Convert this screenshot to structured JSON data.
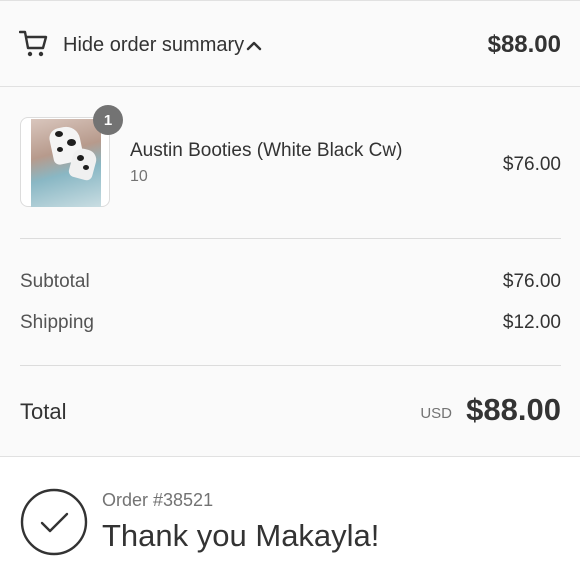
{
  "summary_toggle": {
    "label": "Hide order summary",
    "total": "$88.00",
    "icons": [
      "cart-icon",
      "chevron-up-icon"
    ]
  },
  "line_items": [
    {
      "name": "Austin Booties (White Black Cw)",
      "variant": "10",
      "quantity": "1",
      "price": "$76.00"
    }
  ],
  "costs": {
    "subtotal_label": "Subtotal",
    "subtotal_value": "$76.00",
    "shipping_label": "Shipping",
    "shipping_value": "$12.00"
  },
  "total": {
    "label": "Total",
    "currency": "USD",
    "value": "$88.00"
  },
  "confirmation": {
    "order_number": "Order #38521",
    "message": "Thank you Makayla!",
    "icon": "check-circle-icon"
  },
  "colors": {
    "panel_background": "#fafafa",
    "text": "#333333",
    "muted_text": "#737373",
    "badge": "#737373",
    "divider": "#dcdcdc"
  }
}
